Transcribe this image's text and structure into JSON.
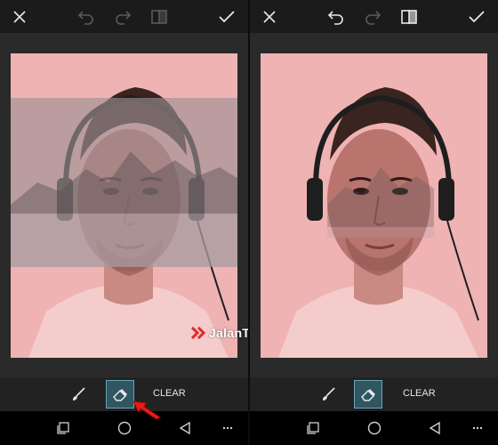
{
  "watermark": {
    "text": "JalanTikus",
    "color": "#e02a2a"
  },
  "panes": [
    {
      "id": "before",
      "clear_label": "CLEAR"
    },
    {
      "id": "after",
      "clear_label": "CLEAR"
    }
  ],
  "icons": {
    "close": "close-icon",
    "undo": "undo-icon",
    "redo": "redo-icon",
    "compare": "compare-icon",
    "apply": "check-icon",
    "brush": "brush-icon",
    "eraser": "eraser-icon",
    "recents": "recents-icon",
    "home": "home-icon",
    "back": "back-icon",
    "more": "more-icon"
  },
  "colors": {
    "photo_tint": "#efb3b3",
    "active_tool_bg": "#2f5661",
    "active_tool_border": "#6aa4b4",
    "annotation_arrow": "#e0201e"
  }
}
